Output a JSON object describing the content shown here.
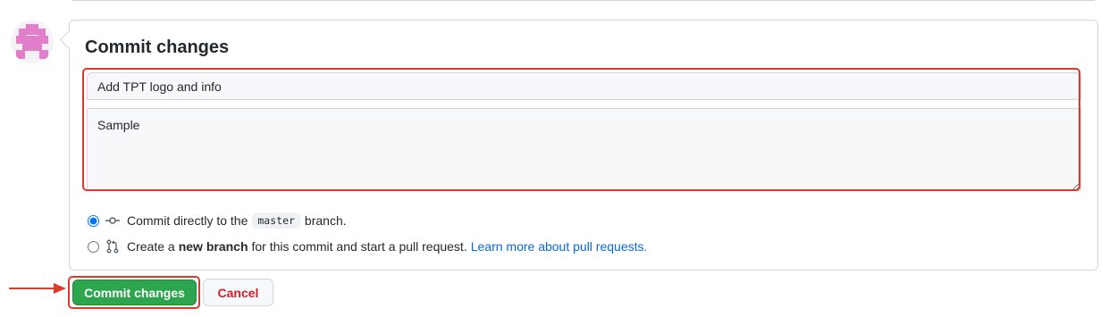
{
  "commit_form": {
    "title": "Commit changes",
    "summary_value": "Add TPT logo and info",
    "description_value": "Sample"
  },
  "options": {
    "direct": {
      "text_before": "Commit directly to the",
      "branch_name": "master",
      "text_after": "branch.",
      "selected": true
    },
    "new_branch": {
      "text_before": "Create a",
      "bold_text": "new branch",
      "text_after": "for this commit and start a pull request.",
      "link_text": "Learn more about pull requests.",
      "selected": false
    }
  },
  "actions": {
    "commit_label": "Commit changes",
    "cancel_label": "Cancel"
  },
  "colors": {
    "highlight": "#e0392b",
    "primary_button": "#2da44e",
    "cancel_text": "#cf222e",
    "link": "#0969da",
    "avatar": "#e27fca"
  }
}
